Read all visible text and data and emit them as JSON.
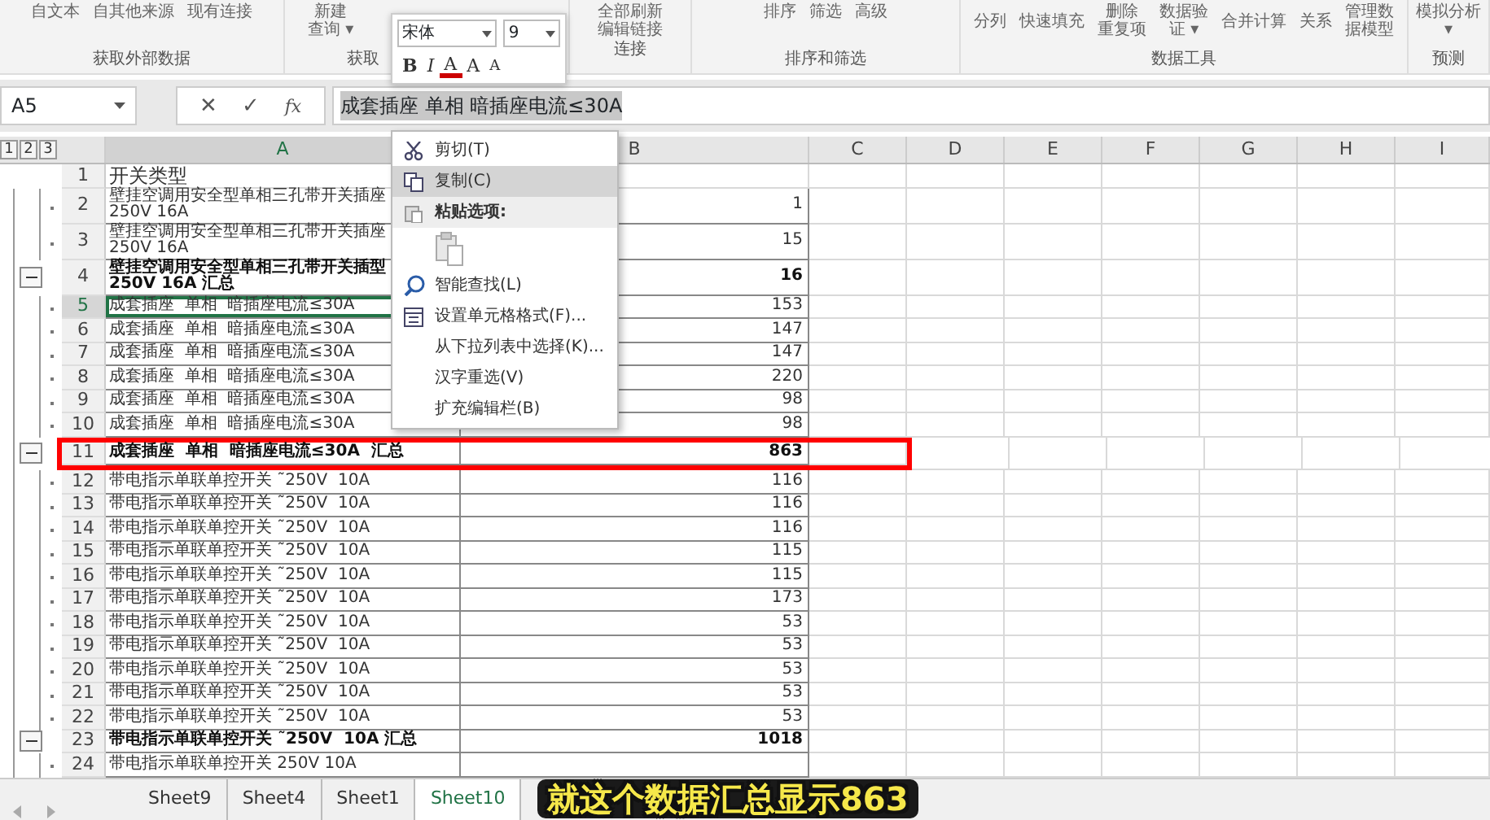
{
  "ribbon": {
    "groups": [
      {
        "label": "获取外部数据",
        "kind": "row",
        "items": [
          [
            "自文本"
          ],
          [
            "自其他来源"
          ],
          [
            "现有连接"
          ]
        ]
      },
      {
        "label": "获取",
        "kind": "row",
        "items": [
          [
            "新建",
            "查询 ▾"
          ]
        ]
      },
      {
        "label": "连接",
        "kind": "stack",
        "items": [
          [
            "全部刷新"
          ],
          [
            "编辑链接"
          ]
        ]
      },
      {
        "label": "排序和筛选",
        "kind": "row",
        "items": [
          [
            "排序"
          ],
          [
            "筛选"
          ],
          [
            "高级"
          ]
        ]
      },
      {
        "label": "数据工具",
        "kind": "row",
        "items": [
          [
            "分列"
          ],
          [
            "快速填充"
          ],
          [
            "删除",
            "重复项"
          ],
          [
            "数据验",
            "证 ▾"
          ],
          [
            "合并计算"
          ],
          [
            "关系"
          ],
          [
            "管理数",
            "据模型"
          ]
        ]
      },
      {
        "label": "预测",
        "kind": "row",
        "items": [
          [
            "模拟分析",
            "▾"
          ]
        ]
      }
    ]
  },
  "mini_toolbar": {
    "font": "宋体",
    "size": "9",
    "buttons": [
      "B",
      "I",
      "A",
      "A",
      "A"
    ]
  },
  "formula_bar": {
    "name_box": "A5",
    "buttons": [
      "✕",
      "✓",
      "fx"
    ],
    "formula": "成套插座 单相 暗插座电流≤30A"
  },
  "outline_levels": [
    "1",
    "2",
    "3"
  ],
  "columns": [
    "A",
    "B",
    "C",
    "D",
    "E",
    "F",
    "G",
    "H",
    "I"
  ],
  "rows": [
    {
      "num": "1",
      "kind": "header",
      "selected": false,
      "a": "开关类型",
      "b": ""
    },
    {
      "num": "2",
      "kind": "detail",
      "selected": false,
      "wrapped": true,
      "a": "壁挂空调用安全型单相三孔带开关插座 250V 16A",
      "b": "1"
    },
    {
      "num": "3",
      "kind": "detail",
      "selected": false,
      "wrapped": true,
      "a": "壁挂空调用安全型单相三孔带开关插座 250V 16A",
      "b": "15"
    },
    {
      "num": "4",
      "kind": "summary",
      "selected": false,
      "wrapped": true,
      "a": "壁挂空调用安全型单相三孔带开关插型 250V 16A 汇总",
      "b": "16"
    },
    {
      "num": "5",
      "kind": "detail",
      "selected": true,
      "a": "成套插座  单相  暗插座电流≤30A",
      "b": "153"
    },
    {
      "num": "6",
      "kind": "detail",
      "selected": false,
      "a": "成套插座  单相  暗插座电流≤30A",
      "b": "147"
    },
    {
      "num": "7",
      "kind": "detail",
      "selected": false,
      "a": "成套插座  单相  暗插座电流≤30A",
      "b": "147"
    },
    {
      "num": "8",
      "kind": "detail",
      "selected": false,
      "a": "成套插座  单相  暗插座电流≤30A",
      "b": "220"
    },
    {
      "num": "9",
      "kind": "detail",
      "selected": false,
      "a": "成套插座  单相  暗插座电流≤30A",
      "b": "98"
    },
    {
      "num": "10",
      "kind": "detail",
      "selected": false,
      "a": "成套插座  单相  暗插座电流≤30A",
      "b": "98"
    },
    {
      "num": "11",
      "kind": "summary",
      "selected": false,
      "annotated": true,
      "a": "成套插座  单相  暗插座电流≤30A  汇总",
      "b": "863"
    },
    {
      "num": "12",
      "kind": "detail",
      "selected": false,
      "a": "带电指示单联单控开关 ˜250V  10A",
      "b": "116"
    },
    {
      "num": "13",
      "kind": "detail",
      "selected": false,
      "a": "带电指示单联单控开关 ˜250V  10A",
      "b": "116"
    },
    {
      "num": "14",
      "kind": "detail",
      "selected": false,
      "a": "带电指示单联单控开关 ˜250V  10A",
      "b": "116"
    },
    {
      "num": "15",
      "kind": "detail",
      "selected": false,
      "a": "带电指示单联单控开关 ˜250V  10A",
      "b": "115"
    },
    {
      "num": "16",
      "kind": "detail",
      "selected": false,
      "a": "带电指示单联单控开关 ˜250V  10A",
      "b": "115"
    },
    {
      "num": "17",
      "kind": "detail",
      "selected": false,
      "a": "带电指示单联单控开关 ˜250V  10A",
      "b": "173"
    },
    {
      "num": "18",
      "kind": "detail",
      "selected": false,
      "a": "带电指示单联单控开关 ˜250V  10A",
      "b": "53"
    },
    {
      "num": "19",
      "kind": "detail",
      "selected": false,
      "a": "带电指示单联单控开关 ˜250V  10A",
      "b": "53"
    },
    {
      "num": "20",
      "kind": "detail",
      "selected": false,
      "a": "带电指示单联单控开关 ˜250V  10A",
      "b": "53"
    },
    {
      "num": "21",
      "kind": "detail",
      "selected": false,
      "a": "带电指示单联单控开关 ˜250V  10A",
      "b": "53"
    },
    {
      "num": "22",
      "kind": "detail",
      "selected": false,
      "a": "带电指示单联单控开关 ˜250V  10A",
      "b": "53"
    },
    {
      "num": "23",
      "kind": "summary",
      "selected": false,
      "a": "带电指示单联单控开关 ˜250V  10A 汇总",
      "b": "1018"
    },
    {
      "num": "24",
      "kind": "detail",
      "selected": false,
      "a": "带电指示单联单控开关 250V 10A",
      "b": ""
    }
  ],
  "context_menu": [
    {
      "kind": "item",
      "label": "剪切(T)",
      "selected": false
    },
    {
      "kind": "item",
      "label": "复制(C)",
      "selected": true
    },
    {
      "kind": "heading",
      "label": "粘贴选项:",
      "selected": false
    },
    {
      "kind": "paste"
    },
    {
      "kind": "item",
      "label": "智能查找(L)",
      "selected": false
    },
    {
      "kind": "item",
      "label": "设置单元格格式(F)...",
      "selected": false
    },
    {
      "kind": "item",
      "label": "从下拉列表中选择(K)...",
      "selected": false
    },
    {
      "kind": "item",
      "label": "汉字重选(V)",
      "selected": false
    },
    {
      "kind": "item",
      "label": "扩充编辑栏(B)",
      "selected": false
    }
  ],
  "sheet_tabs": [
    {
      "label": "Sheet9",
      "selected": false
    },
    {
      "label": "Sheet4",
      "selected": false
    },
    {
      "label": "Sheet1",
      "selected": false
    },
    {
      "label": "Sheet10",
      "selected": true
    }
  ],
  "caption": "就这个数据汇总显示863"
}
